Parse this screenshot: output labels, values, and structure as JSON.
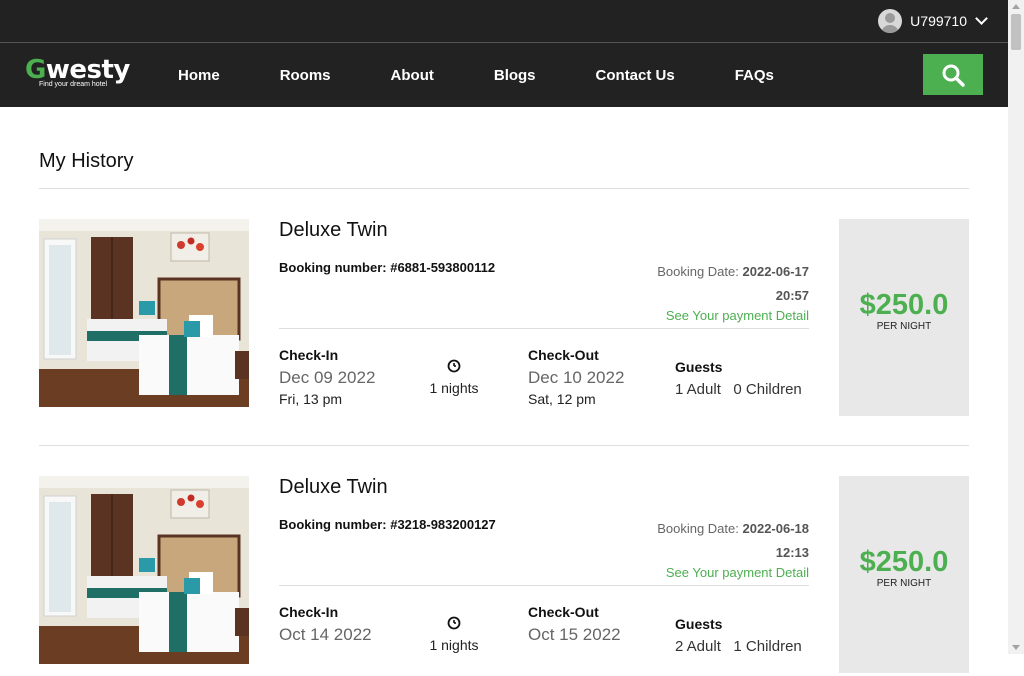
{
  "header": {
    "username": "U799710",
    "logo_word_g": "G",
    "logo_word_rest": "westy",
    "logo_tagline": "Find your dream hotel",
    "nav": [
      {
        "label": "Home"
      },
      {
        "label": "Rooms"
      },
      {
        "label": "About"
      },
      {
        "label": "Blogs"
      },
      {
        "label": "Contact Us"
      },
      {
        "label": "FAQs"
      }
    ]
  },
  "colors": {
    "accent": "#4caf50",
    "header_bg": "#222222",
    "price_box_bg": "#e8e8e8"
  },
  "page": {
    "title": "My History"
  },
  "bookings": [
    {
      "room": "Deluxe Twin",
      "booking_number": "Booking number: #6881-593800112",
      "booking_date_label": "Booking Date:",
      "booking_date": "2022-06-17",
      "booking_time": "20:57",
      "payment_link": "See Your payment Detail",
      "checkin_label": "Check-In",
      "checkin_date": "Dec 09 2022",
      "checkin_time": "Fri, 13 pm",
      "nights": "1 nights",
      "checkout_label": "Check-Out",
      "checkout_date": "Dec 10 2022",
      "checkout_time": "Sat, 12 pm",
      "guests_label": "Guests",
      "adults": "1 Adult",
      "children": "0 Children",
      "price": "$250.0",
      "per_night": "PER NIGHT"
    },
    {
      "room": "Deluxe Twin",
      "booking_number": "Booking number: #3218-983200127",
      "booking_date_label": "Booking Date:",
      "booking_date": "2022-06-18",
      "booking_time": "12:13",
      "payment_link": "See Your payment Detail",
      "checkin_label": "Check-In",
      "checkin_date": "Oct 14 2022",
      "checkin_time": "",
      "nights": "1 nights",
      "checkout_label": "Check-Out",
      "checkout_date": "Oct 15 2022",
      "checkout_time": "",
      "guests_label": "Guests",
      "adults": "2 Adult",
      "children": "1 Children",
      "price": "$250.0",
      "per_night": "PER NIGHT"
    }
  ]
}
